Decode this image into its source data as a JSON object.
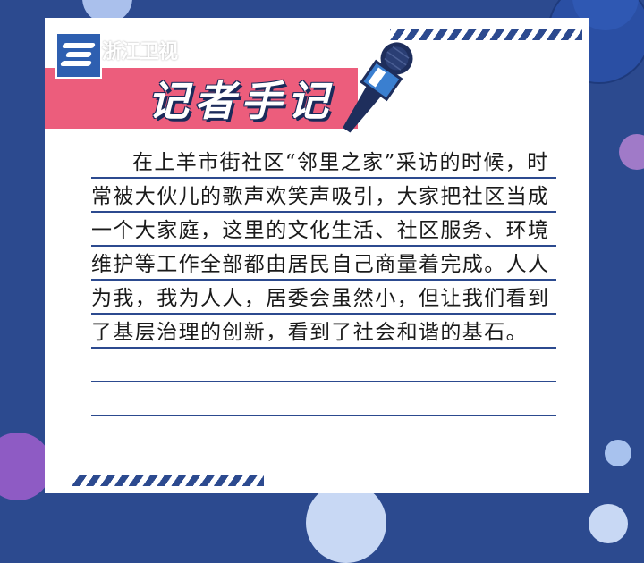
{
  "logo": {
    "text": "浙江卫视"
  },
  "card": {
    "title": "记者手记",
    "body": "在上羊市街社区“邻里之家”采访的时候，时常被大伙儿的歌声欢笑声吸引，大家把社区当成一个大家庭，这里的文化生活、社区服务、环境维护等工作全部都由居民自己商量着完成。人人为我，我为人人，居委会虽然小，但让我们看到了基层治理的创新，看到了社会和谐的基石。"
  },
  "icons": [
    "microphone-icon",
    "tv-station-logo-icon"
  ],
  "colors": {
    "background": "#2c4a8f",
    "accent_pink": "#ec5d7c",
    "card": "#ffffff"
  }
}
